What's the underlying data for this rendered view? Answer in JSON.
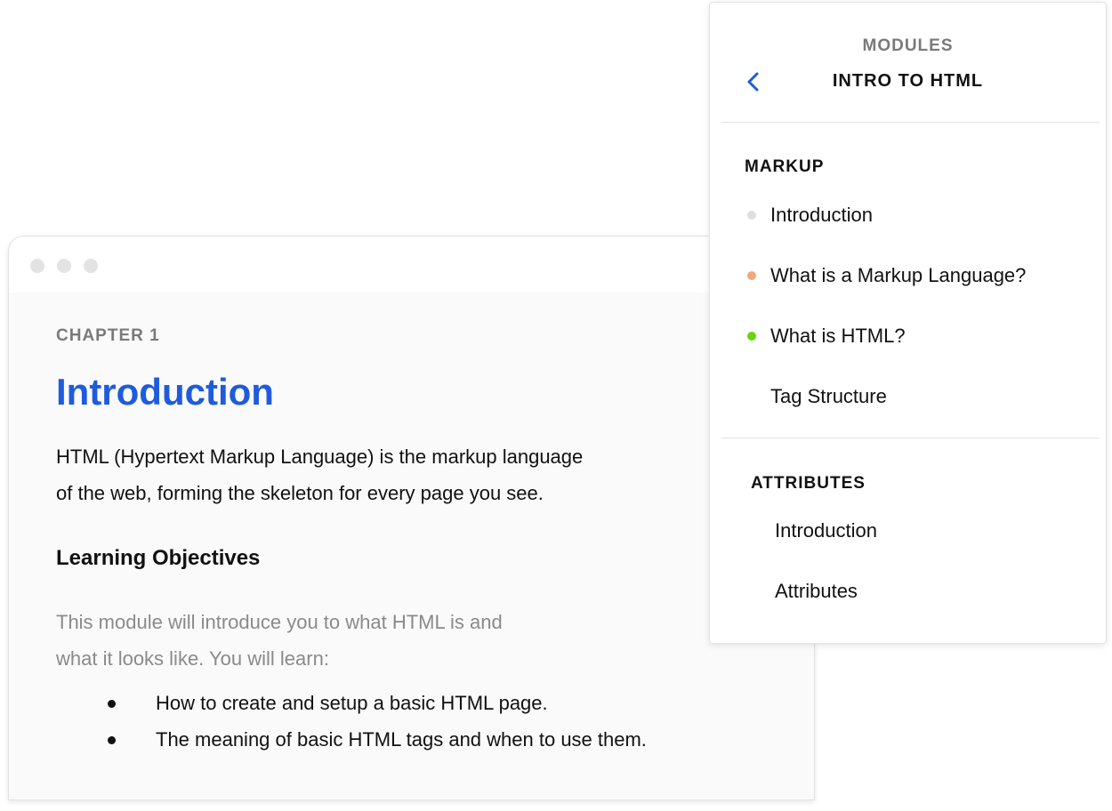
{
  "lesson": {
    "chapter": "CHAPTER 1",
    "title": "Introduction",
    "intro_line1": "HTML (Hypertext Markup Language) is the markup language",
    "intro_line2": "of the web, forming the skeleton for every page you see.",
    "objectives_heading": "Learning Objectives",
    "desc_line1": "This module will introduce you to what HTML is and",
    "desc_line2": "what it looks like. You will learn:",
    "objectives": [
      "How to create and setup a basic HTML page.",
      "The meaning of basic HTML tags and when to use them."
    ]
  },
  "modules_panel": {
    "label": "MODULES",
    "module_title": "INTRO TO HTML",
    "back_icon": "chevron-left-icon",
    "sections": [
      {
        "title": "MARKUP",
        "items": [
          {
            "label": "Introduction",
            "status_color": "#dedede"
          },
          {
            "label": "What is a Markup Language?",
            "status_color": "#f4a77b"
          },
          {
            "label": "What is HTML?",
            "status_color": "#6ad40e"
          },
          {
            "label": "Tag Structure",
            "status_color": ""
          }
        ]
      },
      {
        "title": "ATTRIBUTES",
        "items": [
          {
            "label": "Introduction",
            "status_color": ""
          },
          {
            "label": "Attributes",
            "status_color": ""
          }
        ]
      }
    ]
  },
  "colors": {
    "accent": "#1f5bdc",
    "muted_text": "#8a8a8a"
  }
}
